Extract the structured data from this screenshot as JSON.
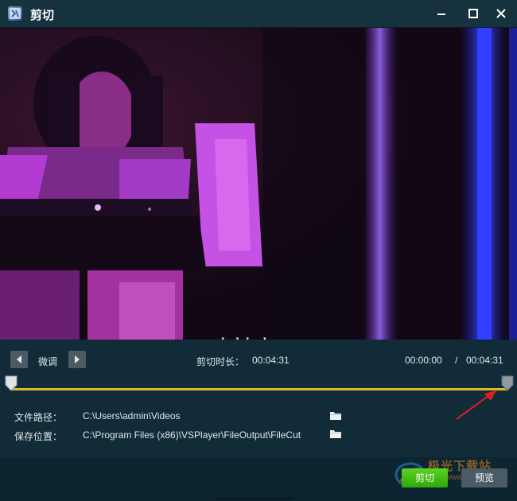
{
  "window": {
    "title": "剪切",
    "minimize_icon": "minimize-icon",
    "maximize_icon": "maximize-icon",
    "close_icon": "close-icon"
  },
  "video": {
    "overlay_text": "geobukdeok"
  },
  "controls": {
    "fine_tune_label": "微调",
    "cut_duration_label": "剪切时长：",
    "cut_duration_value": "00:04:31",
    "current_time": "00:00:00",
    "separator": "/",
    "total_time": "00:04:31",
    "range_start_fraction": 0.0,
    "range_end_fraction": 1.0
  },
  "paths": {
    "file_path_label": "文件路径：",
    "file_path_value": "C:\\Users\\admin\\Videos",
    "save_location_label": "保存位置：",
    "save_location_value": "C:\\Program Files (x86)\\VSPlayer\\FileOutput\\FileCut"
  },
  "footer": {
    "cut_button": "剪切",
    "preview_button": "预览",
    "brand_text": "极光下载站",
    "brand_sub": "www.xz7.com"
  },
  "colors": {
    "accent_green": "#3fbf14",
    "track_yellow": "#e0b72a",
    "annotation_red": "#e02020"
  }
}
